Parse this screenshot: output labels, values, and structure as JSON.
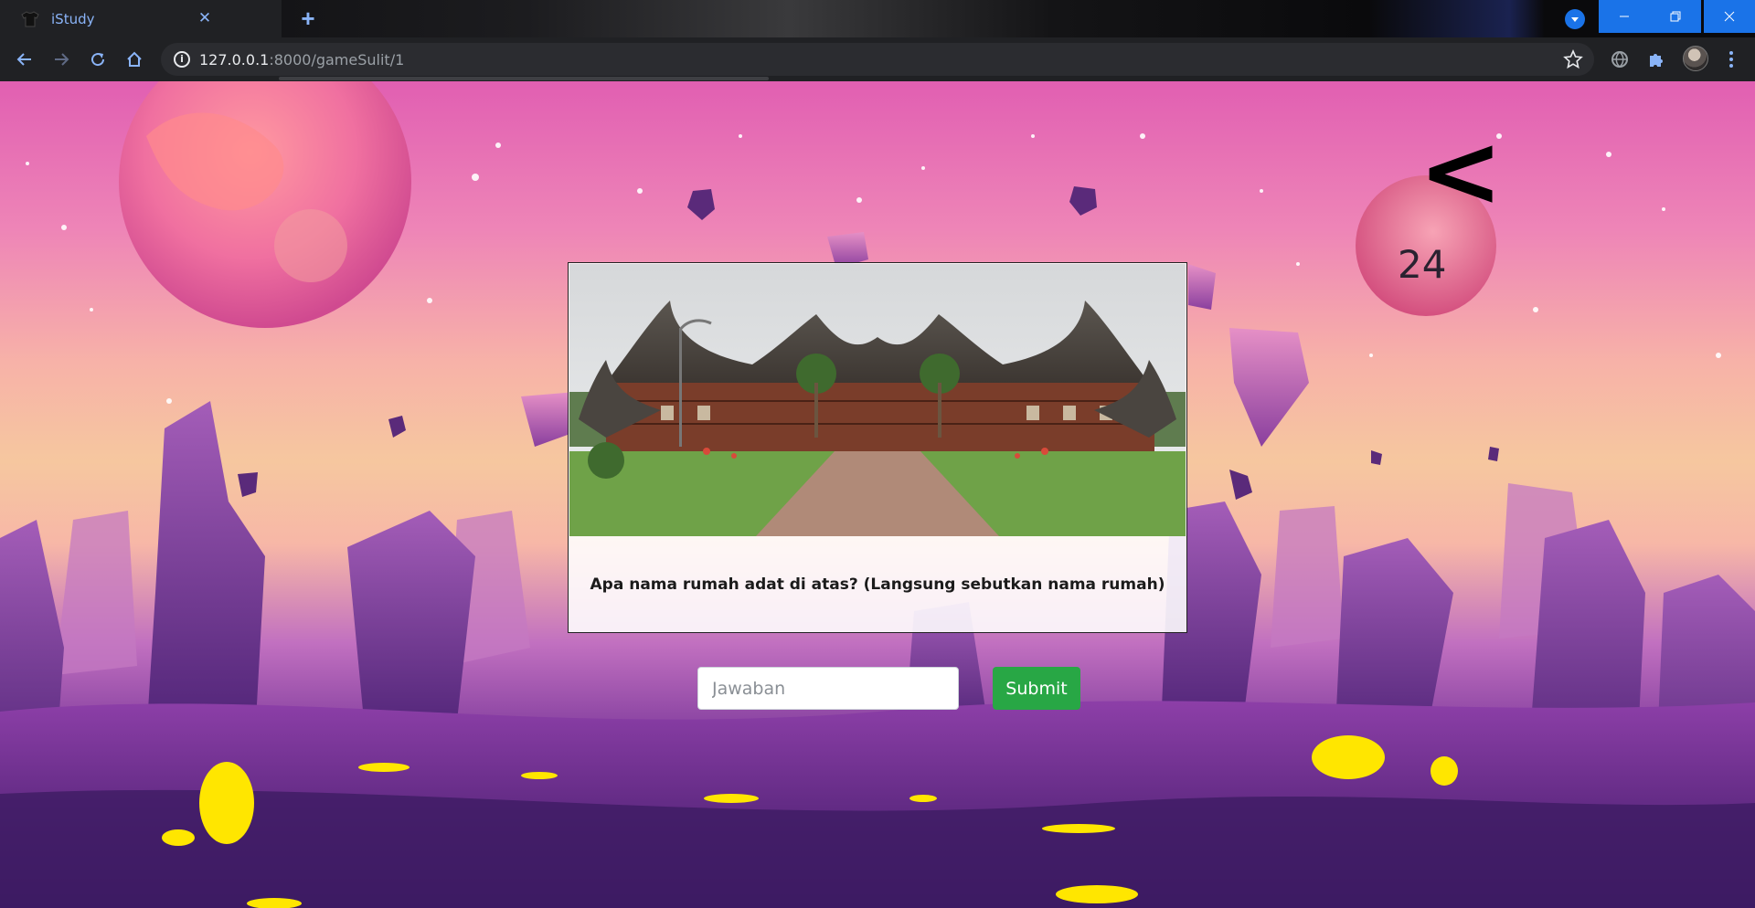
{
  "browser": {
    "tab_title": "iStudy",
    "url_host": "127.0.0.1",
    "url_rest": ":8000/gameSulit/1",
    "accent_color": "#1a73e8"
  },
  "icons": {
    "back": "arrow-left-icon",
    "forward": "arrow-right-icon",
    "reload": "reload-icon",
    "home": "home-icon",
    "info": "info-icon",
    "bookmark": "star-icon",
    "extensions": "puzzle-icon"
  },
  "game": {
    "back_symbol": "<",
    "timer": "24",
    "question": "Apa nama rumah adat di atas? (Langsung sebutkan nama rumah)",
    "answer_placeholder": "Jawaban",
    "submit_label": "Submit",
    "submit_color": "#28a745"
  }
}
